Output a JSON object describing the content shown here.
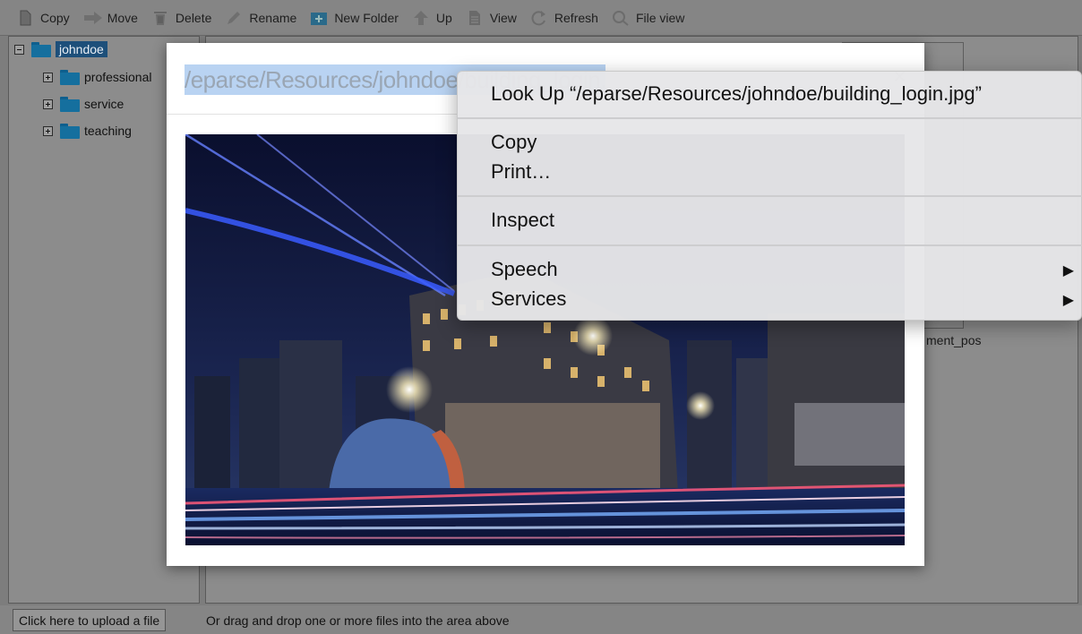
{
  "toolbar": {
    "buttons": [
      {
        "label": "Copy",
        "icon": "copy-icon"
      },
      {
        "label": "Move",
        "icon": "move-arrow-icon"
      },
      {
        "label": "Delete",
        "icon": "trash-icon"
      },
      {
        "label": "Rename",
        "icon": "pencil-icon"
      },
      {
        "label": "New Folder",
        "icon": "new-folder-icon"
      },
      {
        "label": "Up",
        "icon": "up-arrow-icon"
      },
      {
        "label": "View",
        "icon": "view-document-icon"
      },
      {
        "label": "Refresh",
        "icon": "refresh-icon"
      },
      {
        "label": "File view",
        "icon": "magnifier-icon"
      }
    ]
  },
  "tree": {
    "root": {
      "label": "johndoe",
      "expanded": true,
      "selected": true
    },
    "children": [
      {
        "label": "professional"
      },
      {
        "label": "service"
      },
      {
        "label": "teaching"
      }
    ]
  },
  "content": {
    "tile_caption": "ment_pos"
  },
  "modal": {
    "title": "/eparse/Resources/johndoe/building_login.jpg",
    "close_label": "×"
  },
  "context_menu": {
    "look_up": "Look Up “/eparse/Resources/johndoe/building_login.jpg”",
    "copy": "Copy",
    "print": "Print…",
    "inspect": "Inspect",
    "speech": "Speech",
    "services": "Services",
    "submenu_arrow": "▶"
  },
  "upload": {
    "button_label": "Click here to upload a file",
    "hint": "Or drag and drop one or more files into the area above"
  },
  "colors": {
    "folder": "#156f9e",
    "selection": "#1d4f7a",
    "title_highlight": "#b9d3f2"
  }
}
